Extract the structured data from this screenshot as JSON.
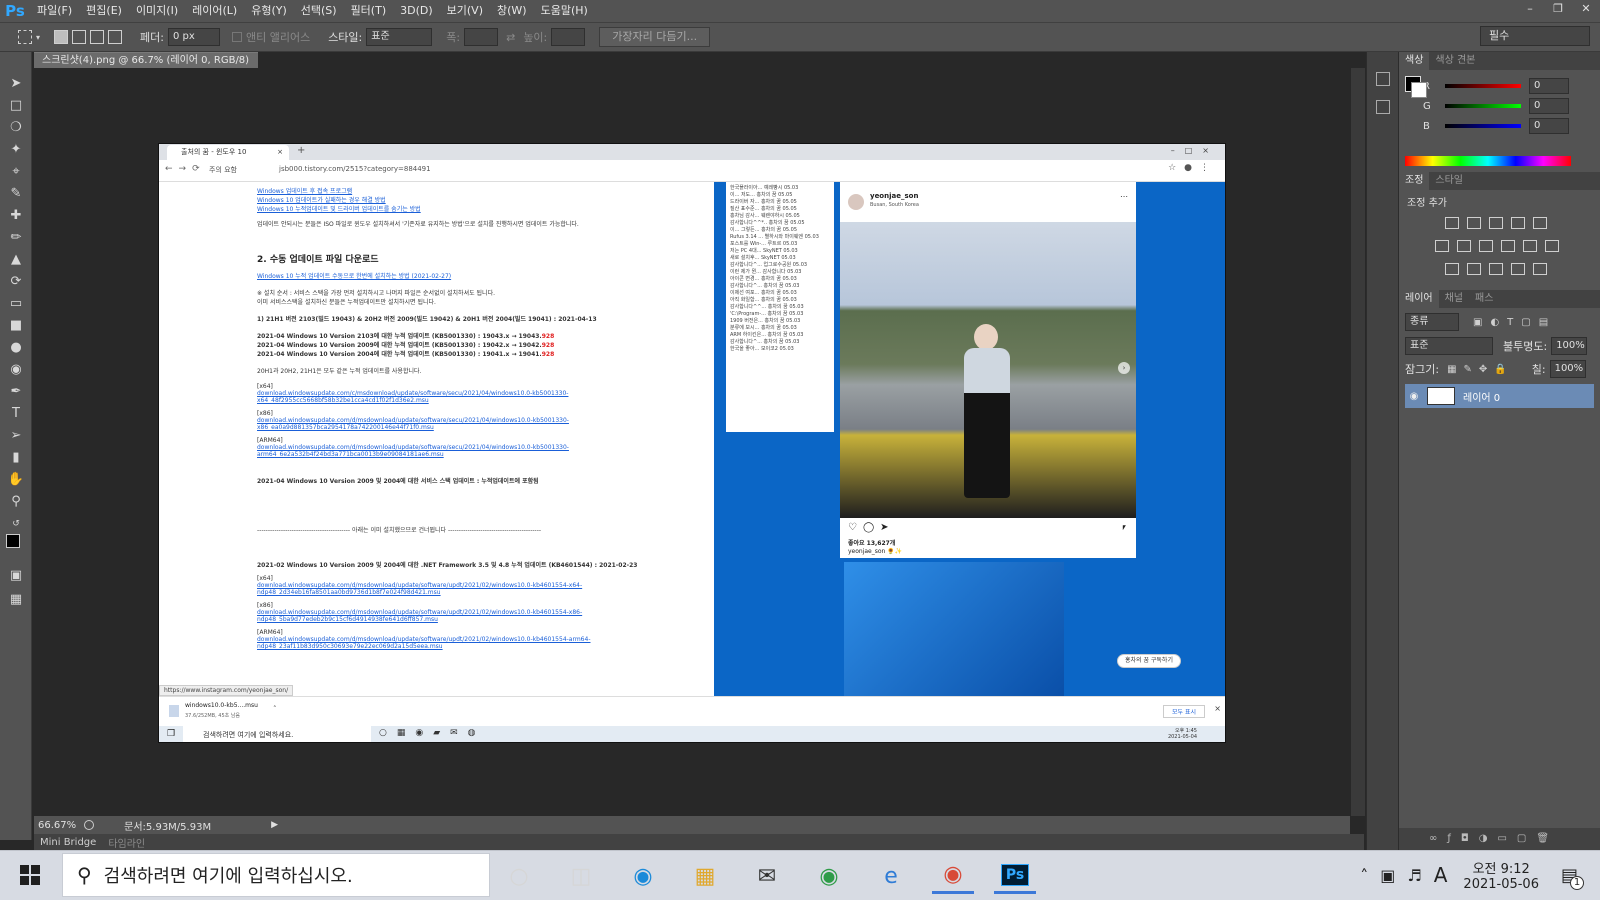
{
  "app": {
    "logo": "Ps"
  },
  "menu": [
    "파일(F)",
    "편집(E)",
    "이미지(I)",
    "레이어(L)",
    "유형(Y)",
    "선택(S)",
    "필터(T)",
    "3D(D)",
    "보기(V)",
    "창(W)",
    "도움말(H)"
  ],
  "options": {
    "feather_label": "페더:",
    "feather_value": "0 px",
    "antialias_label": "앤티 앨리어스",
    "style_label": "스타일:",
    "style_value": "표준",
    "width_label": "폭:",
    "height_label": "높이:",
    "refine_edge": "가장자리 다듬기..."
  },
  "workspace": "필수",
  "document": {
    "tab_title": "스크린샷(4).png @ 66.7% (레이어 0, RGB/8)",
    "zoom": "66.67%",
    "doc_size": "문서:5.93M/5.93M"
  },
  "bottom_tabs": [
    "Mini Bridge",
    "타임라인"
  ],
  "color_panel": {
    "tabs": [
      "색상",
      "색상 견본"
    ],
    "r_label": "R",
    "g_label": "G",
    "b_label": "B",
    "r": "0",
    "g": "0",
    "b": "0"
  },
  "adjust_panel": {
    "tabs": [
      "조정",
      "스타일"
    ],
    "title": "조정 추가"
  },
  "layers_panel": {
    "tabs": [
      "레이어",
      "채널",
      "패스"
    ],
    "filter": "종류",
    "blend_mode": "표준",
    "opacity_label": "불투명도:",
    "opacity": "100%",
    "lock_label": "잠그기:",
    "fill_label": "칠:",
    "fill": "100%",
    "layer_name": "레이어 0"
  },
  "shot": {
    "tab_title": "출처의 꿈 - 윈도우 10",
    "address": "jsb000.tistory.com/2515?category=884491",
    "security": "주의 요함",
    "blog_links": [
      "Windows 업데이트 후 접속 프로그램",
      "Windows 10 업데이트가 실패하는 경우 해결 방법",
      "Windows 10 누적업데이트 및 드라이버 업데이트를 숨기는 방법"
    ],
    "blog_note": "업데이트 안되시는 분들은 ISO 파일로 윈도우 설치하셔서 '기존자료 유지하는 방법'으로 설치를 진행하시면 업데이트 가능합니다.",
    "heading": "2. 수동 업데이트 파일 다운로드",
    "link2": "Windows 10 누적 업데이트 수동으로 한번에 설치하는 방법 (2021-02-27)",
    "install_order": "※ 설치 순서 : 서비스 스택을 가장 먼저 설치하시고 나머지 파일은 순서없이 설치하셔도 됩니다.",
    "install_note": "이미 서비스스택을 설치하신 분들은 누적업데이트만 설치하시면 됩니다.",
    "version_line": "1) 21H1 버전 2103(빌드 19043) & 20H2 버전 2009(빌드 19042) & 20H1 버전 2004(빌드 19041) : 2021-04-13",
    "kb_lines": [
      "2021-04 Windows 10 Version 2103에 대한 누적 업데이트 (KB5001330) : 19043.x → 19043.",
      "2021-04 Windows 10 Version 2009에 대한 누적 업데이트 (KB5001330) : 19042.x → 19042.",
      "2021-04 Windows 10 Version 2004에 대한 누적 업데이트 (KB5001330) : 19041.x → 19041."
    ],
    "kb_suffix": "928",
    "same_note": "20H1과 20H2, 21H1은 모두 같은 누적 업데이트를 사용합니다.",
    "arch_x64": "[x64]",
    "arch_x86": "[x86]",
    "arch_arm": "[ARM64]",
    "url1": "download.windowsupdate.com/c/msdownload/update/software/secu/2021/04/windows10.0-kb5001330-x64_48f2955cc5668bf58b32be1cca4cd1f02f1d36e2.msu",
    "url2": "download.windowsupdate.com/d/msdownload/update/software/secu/2021/04/windows10.0-kb5001330-x86_ea0a9d881357bca2954178a742200146e44f71f0.msu",
    "url3": "download.windowsupdate.com/d/msdownload/update/software/secu/2021/04/windows10.0-kb5001330-arm64_6e2a532b4f24bd3a771bca0013b9e09084181ae6.msu",
    "stack_line": "2021-04 Windows 10 Version 2009 및 2004에 대한 서비스 스택 업데이트 : 누적업데이트에 포함됨",
    "divider": "------------------------------------------- 아래는 이미 설치했으므로 건너뜁니다 -------------------------------------------",
    "net_line": "2021-02 Windows 10 Version 2009 및 2004에 대한 .NET Framework 3.5 및 4.8 누적 업데이트 (KB4601544) : 2021-02-23",
    "url4": "download.windowsupdate.com/d/msdownload/update/software/updt/2021/02/windows10.0-kb4601554-x64-ndp48_2d34eb16fa8501aa0bd9736d1b8f7e024f98d421.msu",
    "url5": "download.windowsupdate.com/d/msdownload/update/software/updt/2021/02/windows10.0-kb4601554-x86-ndp48_5ba9d77edeb2b9c15cf6d4914938fe641d6ff857.msu",
    "url6": "download.windowsupdate.com/d/msdownload/update/software/updt/2021/02/windows10.0-kb4601554-arm64-ndp48_23af11b83d950c30693e79e22ec069d2a15d5eea.msu",
    "status_url": "https://www.instagram.com/yeonjae_son/",
    "list_items": [
      "한국플라이아... 예레빵시 05.03",
      "이... 저도... 홍차의 꿈 05.05",
      "드라이버 자... 홍차의 꿈 05.05",
      "질산 표수준... 홍차의 꿈 05.05",
      "홍차님 감사... 웨렌야하시 05.05",
      "감사합니다^^*.. 홍차의 꿈 05.05",
      "이... 그렇든... 홍차의 꿈 05.05",
      "Rufus 3.14 ... 별하시와 마이웨엔 05.03",
      "포스트를 Win-... 루트르 05.03",
      "저는 PC 4대... SkyNET 05.03",
      "새로 설치후... SkyNET 05.03",
      "감사합니다^... 업그로수공원 05.03",
      "이런 제가 뭔... 감사합니다 05.03",
      "아이콘 변경... 홍차의 꿈 05.03",
      "감사합니다^... 홍차의 꿈 05.03",
      "이제선 여포... 홍차의 꿈 05.03",
      "아직 화일함... 홍차의 꿈 05.03",
      "감사합니다^^... 홍차의 꿈 05.03",
      "'C:\\Program-... 홍차의 꿈 05.03",
      "1909 버전은... 홍차의 꿈 05.03",
      "분류에 보시... 홍차의 꿈 05.03",
      "ARM 하이킨은... 홍차의 꿈 05.03",
      "감사합니다^... 홍차의 꿈 05.03",
      "한국을 좋아... 모이코2 05.03"
    ],
    "insta_user": "yeonjae_son",
    "insta_location": "Busan, South Korea",
    "insta_likes": "좋아요 13,627개",
    "insta_caption": "yeonjae_son 🌻✨",
    "subscribe": "홍차의 꿈 구독하기",
    "download_file": "windows10.0-kb5....msu",
    "download_meta": "37.6/252MB, 45초 남음",
    "show_all": "모두 표시",
    "inner_search": "검색하려면 여기에 입력하세요.",
    "inner_time": "오후 1:45",
    "inner_date": "2021-05-04"
  },
  "taskbar": {
    "search_placeholder": "검색하려면 여기에 입력하십시오.",
    "ime": "A",
    "time": "오전 9:12",
    "date": "2021-05-06",
    "notif_count": "1"
  }
}
